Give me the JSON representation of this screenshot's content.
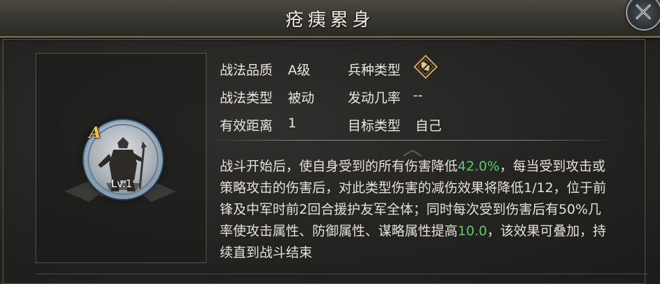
{
  "title": "疮痍累身",
  "portrait": {
    "grade": "A",
    "level": "Lv.1"
  },
  "attributes": {
    "quality": {
      "label": "战法品质",
      "value": "A级"
    },
    "troop_type": {
      "label": "兵种类型",
      "icon": "troop-type-icon"
    },
    "tactic_type": {
      "label": "战法类型",
      "value": "被动"
    },
    "trigger_rate": {
      "label": "发动几率",
      "value": "--"
    },
    "range": {
      "label": "有效距离",
      "value": "1"
    },
    "target_type": {
      "label": "目标类型",
      "value": "自己"
    }
  },
  "description": {
    "p1": "战斗开始后，使自身受到的所有伤害降低",
    "v1": "42.0%",
    "p2": "，每当受到攻击或策略攻击的伤害后，对此类型伤害的减伤效果将降低1/12，位于前锋及中军时前2回合援护友军全体；同时每次受到伤害后有50%几率使攻击属性、防御属性、谋略属性提高",
    "v2": "10.0",
    "p3": "，该效果可叠加，持续直到战斗结束"
  },
  "colors": {
    "highlight": "#5ecb6a",
    "grade": "#f2c14a",
    "title_border": "#8a7650"
  }
}
